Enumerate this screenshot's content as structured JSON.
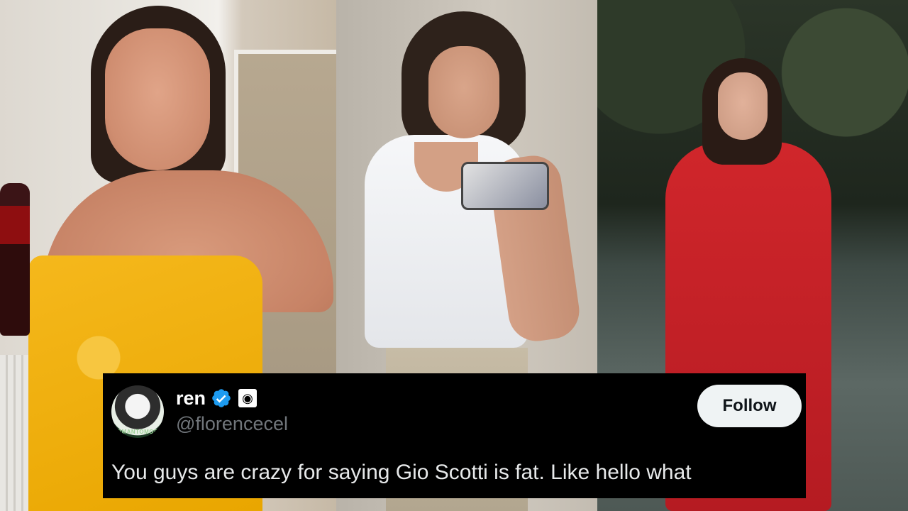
{
  "tweet": {
    "display_name": "ren",
    "handle": "@florencecel",
    "follow_label": "Follow",
    "text": "You guys are crazy for saying Gio Scotti is fat. Like hello what",
    "avatar_text": "ROMANTOMORA",
    "affiliate_badge_glyph": "◉",
    "verified_color": "#1d9bf0"
  },
  "photos": [
    {
      "name": "photo-towel-selfie"
    },
    {
      "name": "photo-mirror-selfie"
    },
    {
      "name": "photo-red-coat"
    }
  ]
}
